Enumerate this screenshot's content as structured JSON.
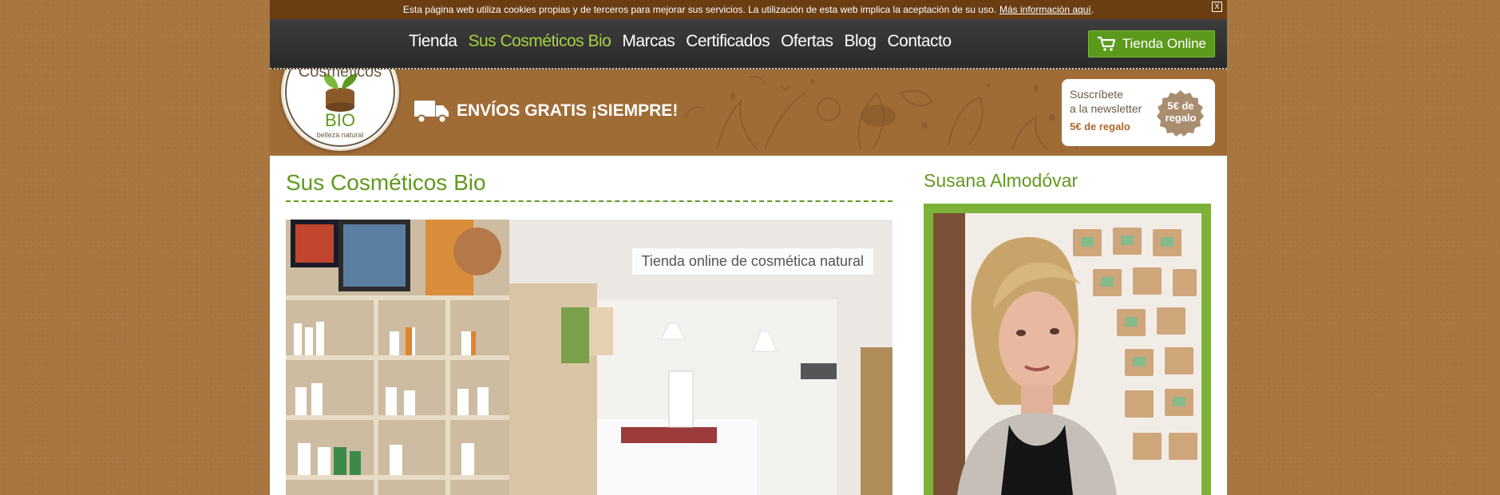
{
  "cookie": {
    "text": "Esta página web utiliza cookies propias y de terceros para mejorar sus servicios. La utilización de esta web implica la aceptación de su uso.",
    "link": "Más información aquí",
    "suffix": ".",
    "close": "X"
  },
  "nav": {
    "items": [
      {
        "label": "Tienda"
      },
      {
        "label": "Sus Cosméticos Bio"
      },
      {
        "label": "Marcas"
      },
      {
        "label": "Certificados"
      },
      {
        "label": "Ofertas"
      },
      {
        "label": "Blog"
      },
      {
        "label": "Contacto"
      }
    ],
    "active_index": 1,
    "shop_button": "Tienda Online"
  },
  "logo": {
    "top_text": "Sus Cosméticos",
    "bottom_text": "BIO",
    "tagline": "belleza natural"
  },
  "banner": {
    "shipping": "ENVÍOS GRATIS ¡SIEMPRE!"
  },
  "newsletter": {
    "line1": "Suscríbete",
    "line2": "a la newsletter",
    "line3": "5€ de regalo",
    "badge_line1": "5€ de",
    "badge_line2": "regalo"
  },
  "main": {
    "title": "Sus Cosméticos Bio",
    "image_caption": "Tienda online de cosmética natural"
  },
  "sidebar": {
    "title": "Susana Almodóvar"
  },
  "colors": {
    "accent_green": "#5f9a1e",
    "nav_active": "#a6d23c",
    "cookie_bar": "#6b3d12",
    "nav_bar": "#333333",
    "background": "#a8763f"
  }
}
